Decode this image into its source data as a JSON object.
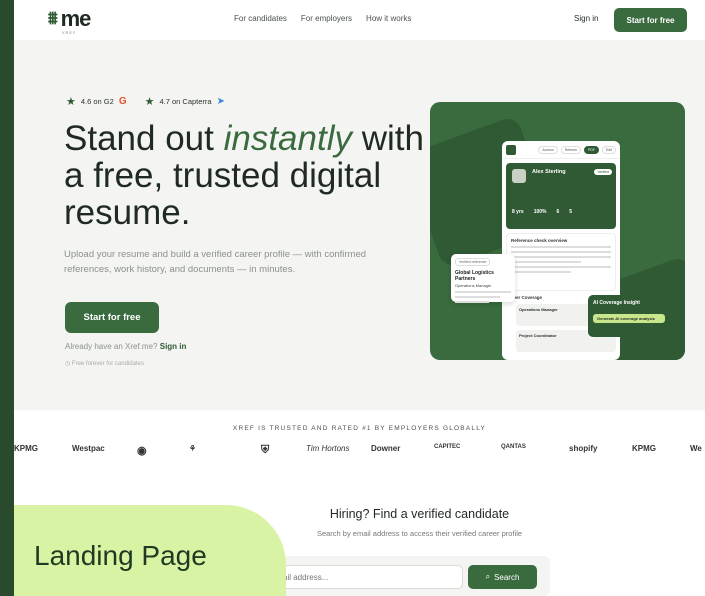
{
  "nav": {
    "logo_mark": "⌖",
    "logo_text": "me",
    "logo_sub": "XREF",
    "links": [
      "For candidates",
      "For employers",
      "How it works"
    ],
    "sign_in": "Sign in",
    "start": "Start for free"
  },
  "hero": {
    "rating_g2": "4.6 on G2",
    "rating_capterra": "4.7 on Capterra",
    "headline_1": "Stand out ",
    "headline_em": "instantly",
    "headline_2": "with a free, trusted digital resume.",
    "sub": "Upload your resume and build a verified career profile — with confirmed references, work history, and documents — in minutes.",
    "cta": "Start for free",
    "already": "Already have an Xref.me?",
    "signin": "Sign in",
    "free_note": "Free forever for candidates"
  },
  "mock": {
    "name": "Alex Sterling",
    "verified": "Verified",
    "stats": [
      "8 yrs",
      "100%",
      "6",
      "5"
    ],
    "ref_title": "Reference check overview",
    "coverage": "Career Coverage",
    "item1": "Operations Manager",
    "item2": "Project Coordinator",
    "float1_tag": "Verified reference",
    "float1_title": "Global Logistics Partners",
    "float1_role": "Operations Manager",
    "float2_title": "AI Coverage Insight",
    "float2_btn": "Generate AI coverage analysis"
  },
  "trusted": {
    "title": "XREF IS TRUSTED AND RATED #1 BY EMPLOYERS GLOBALLY",
    "logos": [
      "KPMG",
      "Westpac",
      "◉",
      "⚘",
      "⛨",
      "Tim Hortons",
      "Downer",
      "CAPITEC",
      "QANTAS",
      "shopify",
      "KPMG",
      "We"
    ]
  },
  "hiring": {
    "title": "Hiring? Find a verified candidate",
    "sub": "Search by email address to access their verified career profile",
    "placeholder": "Email address...",
    "search": "Search"
  },
  "label": "Landing Page",
  "colors": {
    "brand": "#3a6b3e",
    "dark": "#2f5a34",
    "accent": "#d8f3a3"
  }
}
